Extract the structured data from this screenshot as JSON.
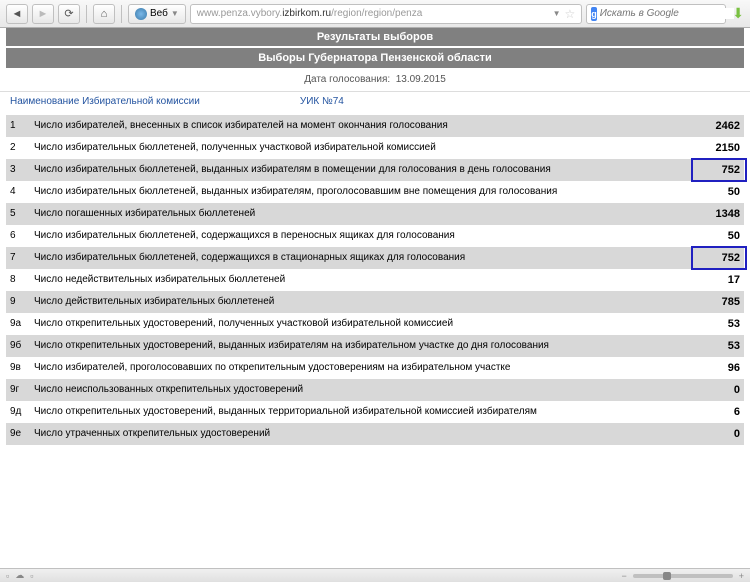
{
  "toolbar": {
    "web_label": "Веб",
    "url_gray1": "www.penza.vybory.",
    "url_dark": "izbirkom.ru",
    "url_gray2": "/region/region/penza",
    "search_placeholder": "Искать в Google"
  },
  "headers": {
    "h1": "Результаты выборов",
    "h2": "Выборы Губернатора Пензенской области",
    "date_label": "Дата голосования:",
    "date_value": "13.09.2015",
    "commission_label": "Наименование Избирательной комиссии",
    "commission_link": "УИК №74"
  },
  "rows": [
    {
      "num": "1",
      "text": "Число избирателей, внесенных в список избирателей на момент окончания голосования",
      "val": "2462",
      "hl": false
    },
    {
      "num": "2",
      "text": "Число избирательных бюллетеней, полученных участковой избирательной комиссией",
      "val": "2150",
      "hl": false
    },
    {
      "num": "3",
      "text": "Число избирательных бюллетеней, выданных избирателям в помещении для голосования в день голосования",
      "val": "752",
      "hl": true
    },
    {
      "num": "4",
      "text": "Число избирательных бюллетеней, выданных избирателям, проголосовавшим вне помещения для голосования",
      "val": "50",
      "hl": false
    },
    {
      "num": "5",
      "text": "Число погашенных избирательных бюллетеней",
      "val": "1348",
      "hl": false
    },
    {
      "num": "6",
      "text": "Число избирательных бюллетеней, содержащихся в переносных ящиках для голосования",
      "val": "50",
      "hl": false
    },
    {
      "num": "7",
      "text": "Число избирательных бюллетеней, содержащихся в стационарных ящиках для голосования",
      "val": "752",
      "hl": true
    },
    {
      "num": "8",
      "text": "Число недействительных избирательных бюллетеней",
      "val": "17",
      "hl": false
    },
    {
      "num": "9",
      "text": "Число действительных избирательных бюллетеней",
      "val": "785",
      "hl": false
    },
    {
      "num": "9а",
      "text": "Число открепительных удостоверений, полученных участковой избирательной комиссией",
      "val": "53",
      "hl": false
    },
    {
      "num": "9б",
      "text": "Число открепительных удостоверений, выданных избирателям на избирательном участке до дня голосования",
      "val": "53",
      "hl": false
    },
    {
      "num": "9в",
      "text": "Число избирателей, проголосовавших по открепительным удостоверениям на избирательном участке",
      "val": "96",
      "hl": false
    },
    {
      "num": "9г",
      "text": "Число неиспользованных открепительных удостоверений",
      "val": "0",
      "hl": false
    },
    {
      "num": "9д",
      "text": "Число открепительных удостоверений, выданных территориальной избирательной комиссией избирателям",
      "val": "6",
      "hl": false
    },
    {
      "num": "9е",
      "text": "Число утраченных открепительных удостоверений",
      "val": "0",
      "hl": false
    }
  ]
}
